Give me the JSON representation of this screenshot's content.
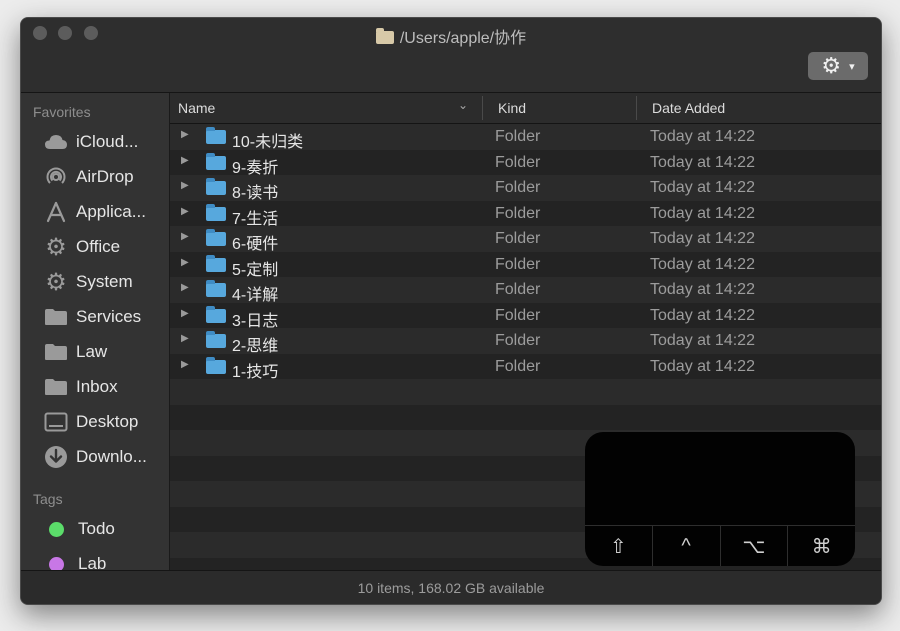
{
  "window": {
    "title": "/Users/apple/协作"
  },
  "toolbar": {
    "gear_icon": "gear-icon",
    "gear_glyph": "⚙",
    "chevron_glyph": "⌄"
  },
  "sidebar": {
    "favorites_header": "Favorites",
    "favorites": [
      {
        "label": "iCloud...",
        "icon": "cloud-icon"
      },
      {
        "label": "AirDrop",
        "icon": "airdrop-icon"
      },
      {
        "label": "Applica...",
        "icon": "applications-icon"
      },
      {
        "label": "Office",
        "icon": "gear-icon"
      },
      {
        "label": "System",
        "icon": "gear-icon"
      },
      {
        "label": "Services",
        "icon": "folder-icon"
      },
      {
        "label": "Law",
        "icon": "folder-icon"
      },
      {
        "label": "Inbox",
        "icon": "folder-icon"
      },
      {
        "label": "Desktop",
        "icon": "desktop-icon"
      },
      {
        "label": "Downlo...",
        "icon": "download-icon"
      }
    ],
    "tags_header": "Tags",
    "tags": [
      {
        "label": "Todo",
        "color": "#5bdc6a"
      },
      {
        "label": "Lab",
        "color": "#c877e6"
      }
    ]
  },
  "columns": {
    "name": "Name",
    "kind": "Kind",
    "date_added": "Date Added"
  },
  "files": [
    {
      "name": "10-未归类",
      "kind": "Folder",
      "date": "Today at 14:22"
    },
    {
      "name": "9-奏折",
      "kind": "Folder",
      "date": "Today at 14:22"
    },
    {
      "name": "8-读书",
      "kind": "Folder",
      "date": "Today at 14:22"
    },
    {
      "name": "7-生活",
      "kind": "Folder",
      "date": "Today at 14:22"
    },
    {
      "name": "6-硬件",
      "kind": "Folder",
      "date": "Today at 14:22"
    },
    {
      "name": "5-定制",
      "kind": "Folder",
      "date": "Today at 14:22"
    },
    {
      "name": "4-详解",
      "kind": "Folder",
      "date": "Today at 14:22"
    },
    {
      "name": "3-日志",
      "kind": "Folder",
      "date": "Today at 14:22"
    },
    {
      "name": "2-思维",
      "kind": "Folder",
      "date": "Today at 14:22"
    },
    {
      "name": "1-技巧",
      "kind": "Folder",
      "date": "Today at 14:22"
    }
  ],
  "status": {
    "text": "10 items, 168.02 GB available"
  },
  "key_overlay": {
    "keys": [
      {
        "glyph": "⇧",
        "icon": "shift-key-icon"
      },
      {
        "glyph": "^",
        "icon": "control-key-icon"
      },
      {
        "glyph": "⌥",
        "icon": "option-key-icon"
      },
      {
        "glyph": "⌘",
        "icon": "command-key-icon"
      }
    ]
  },
  "colors": {
    "folder_blue": "#57a8dd",
    "traffic_light_inactive": "#5c5c5c"
  }
}
